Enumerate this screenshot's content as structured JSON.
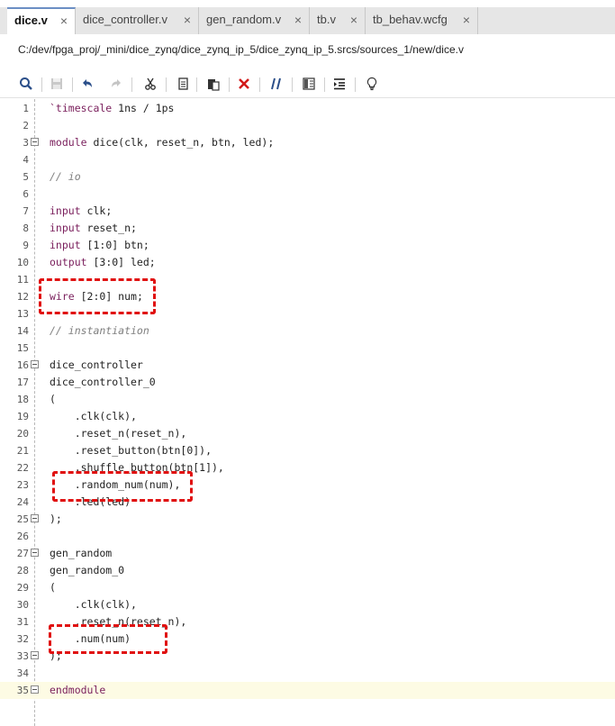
{
  "tabs": [
    {
      "label": "dice.v",
      "active": true
    },
    {
      "label": "dice_controller.v",
      "active": false
    },
    {
      "label": "gen_random.v",
      "active": false
    },
    {
      "label": "tb.v",
      "active": false
    },
    {
      "label": "tb_behav.wcfg",
      "active": false
    }
  ],
  "close_glyph": "×",
  "file_path": "C:/dev/fpga_proj/_mini/dice_zynq/dice_zynq_ip_5/dice_zynq_ip_5.srcs/sources_1/new/dice.v",
  "toolbar": [
    "search-icon",
    "save-icon",
    "undo-icon",
    "redo-icon",
    "cut-icon",
    "copy-icon",
    "paste-icon",
    "delete-icon",
    "comment-icon",
    "toggle-columns-icon",
    "indent-icon",
    "lightbulb-icon"
  ],
  "lines": [
    {
      "n": "1",
      "code": "`timescale 1ns / 1ps"
    },
    {
      "n": "2",
      "code": ""
    },
    {
      "n": "3",
      "code": "module dice(clk, reset_n, btn, led);"
    },
    {
      "n": "4",
      "code": ""
    },
    {
      "n": "5",
      "code": "// io"
    },
    {
      "n": "6",
      "code": ""
    },
    {
      "n": "7",
      "code": "input clk;"
    },
    {
      "n": "8",
      "code": "input reset_n;"
    },
    {
      "n": "9",
      "code": "input [1:0] btn;"
    },
    {
      "n": "10",
      "code": "output [3:0] led;"
    },
    {
      "n": "11",
      "code": ""
    },
    {
      "n": "12",
      "code": "wire [2:0] num;"
    },
    {
      "n": "13",
      "code": ""
    },
    {
      "n": "14",
      "code": "// instantiation"
    },
    {
      "n": "15",
      "code": ""
    },
    {
      "n": "16",
      "code": "dice_controller"
    },
    {
      "n": "17",
      "code": "dice_controller_0"
    },
    {
      "n": "18",
      "code": "("
    },
    {
      "n": "19",
      "code": "    .clk(clk),"
    },
    {
      "n": "20",
      "code": "    .reset_n(reset_n),"
    },
    {
      "n": "21",
      "code": "    .reset_button(btn[0]),"
    },
    {
      "n": "22",
      "code": "    .shuffle_button(btn[1]),"
    },
    {
      "n": "23",
      "code": "    .random_num(num),"
    },
    {
      "n": "24",
      "code": "    .led(led)"
    },
    {
      "n": "25",
      "code": ");"
    },
    {
      "n": "26",
      "code": ""
    },
    {
      "n": "27",
      "code": "gen_random"
    },
    {
      "n": "28",
      "code": "gen_random_0"
    },
    {
      "n": "29",
      "code": "("
    },
    {
      "n": "30",
      "code": "    .clk(clk),"
    },
    {
      "n": "31",
      "code": "    .reset_n(reset_n),"
    },
    {
      "n": "32",
      "code": "    .num(num)"
    },
    {
      "n": "33",
      "code": ");"
    },
    {
      "n": "34",
      "code": ""
    },
    {
      "n": "35",
      "code": "endmodule"
    }
  ],
  "fold_lines": [
    "3",
    "16",
    "25",
    "27",
    "33",
    "35"
  ],
  "highlight_line": "35",
  "colors": {
    "keyword": "#7a1f5c",
    "comment": "#7f7f7f",
    "annotation": "#e01010",
    "highlight": "#fdfbe4"
  }
}
